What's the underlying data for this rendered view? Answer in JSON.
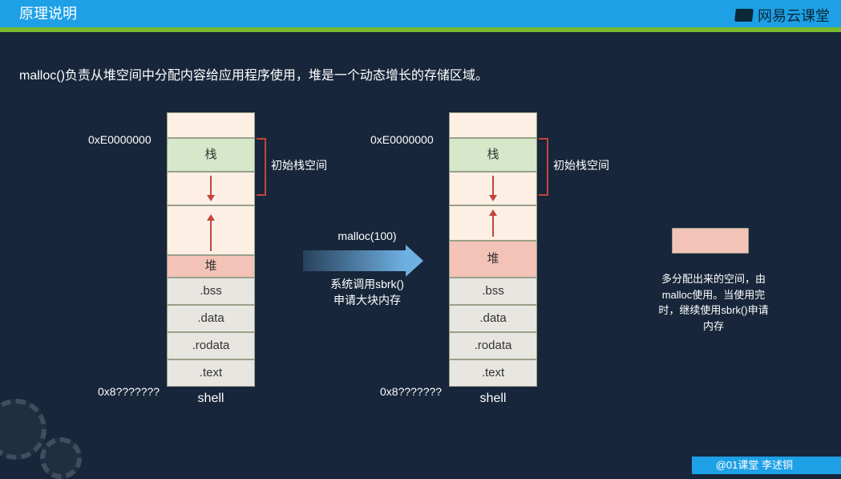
{
  "title": "原理说明",
  "watermark": "网易云课堂",
  "description": "malloc()负责从堆空间中分配内容给应用程序使用，堆是一个动态增长的存储区域。",
  "addr_top": "0xE0000000",
  "addr_bottom": "0x8???????",
  "seg_stack": "栈",
  "seg_heap": "堆",
  "seg_bss": ".bss",
  "seg_data": ".data",
  "seg_rodata": ".rodata",
  "seg_text": ".text",
  "shell_caption": "shell",
  "bracket_label": "初始栈空间",
  "arrow_title": "malloc(100)",
  "arrow_sub1": "系统调用sbrk()",
  "arrow_sub2": "申请大块内存",
  "extra_text": "多分配出来的空间，由malloc使用。当使用完时，继续使用sbrk()申请内存",
  "footer": "@01课堂 李述铜"
}
